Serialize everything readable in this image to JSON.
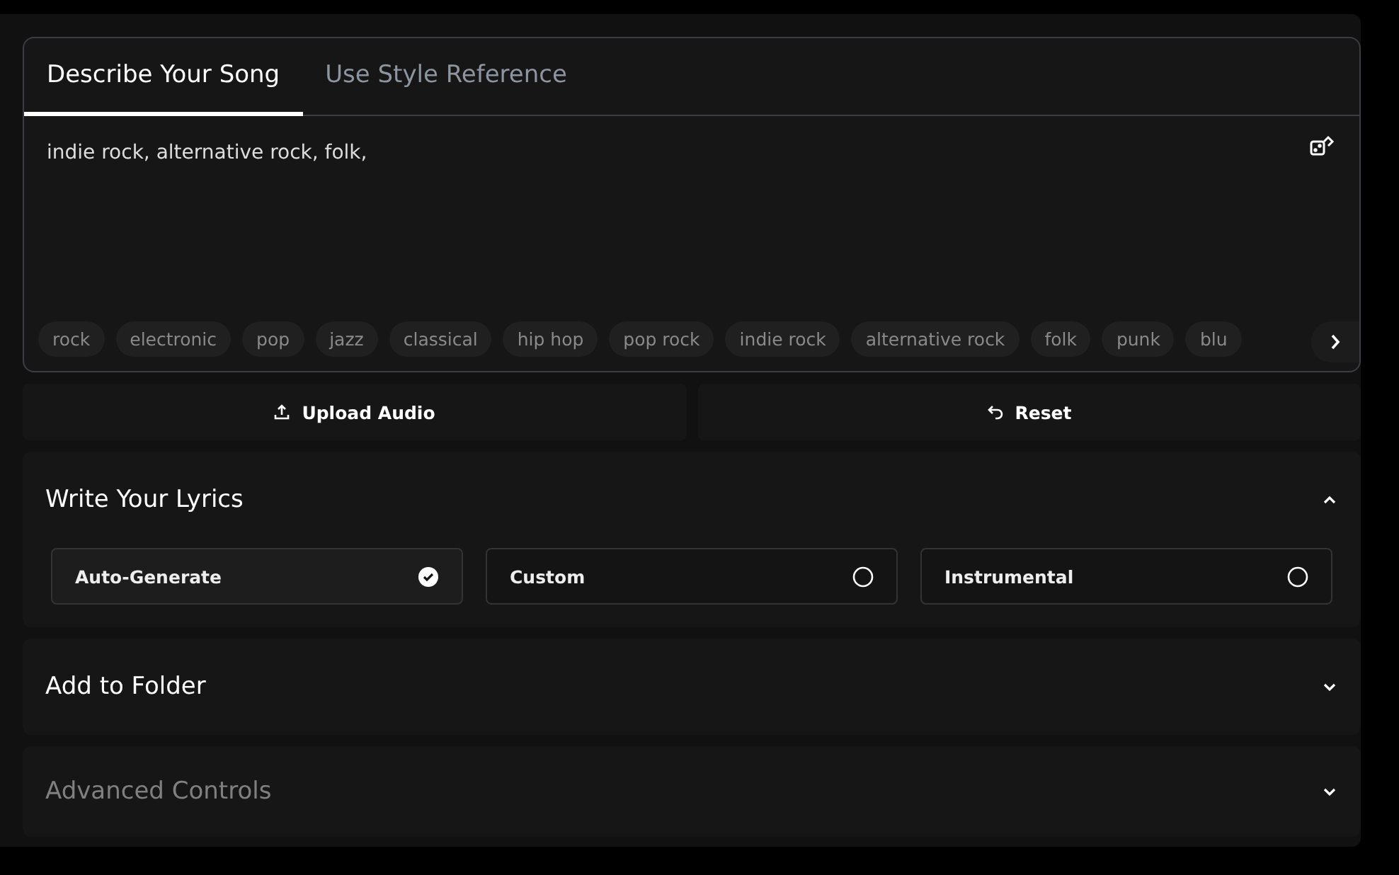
{
  "tabs": [
    {
      "label": "Describe Your Song",
      "selected": true
    },
    {
      "label": "Use Style Reference",
      "selected": false
    }
  ],
  "style_input": {
    "value": "indie rock, alternative rock, folk,"
  },
  "tags": [
    "rock",
    "electronic",
    "pop",
    "jazz",
    "classical",
    "hip hop",
    "pop rock",
    "indie rock",
    "alternative rock",
    "folk",
    "punk",
    "blu"
  ],
  "buttons": [
    {
      "label": "Upload Audio",
      "kind": "upload"
    },
    {
      "label": "Reset",
      "kind": "reset"
    }
  ],
  "sections": [
    {
      "title": "Write Your Lyrics",
      "expanded": true,
      "disabled": false,
      "options": [
        {
          "label": "Auto-Generate",
          "selected": true
        },
        {
          "label": "Custom",
          "selected": false
        },
        {
          "label": "Instrumental",
          "selected": false
        }
      ]
    },
    {
      "title": "Add to Folder",
      "expanded": false,
      "disabled": false
    },
    {
      "title": "Advanced Controls",
      "expanded": false,
      "disabled": true
    }
  ]
}
